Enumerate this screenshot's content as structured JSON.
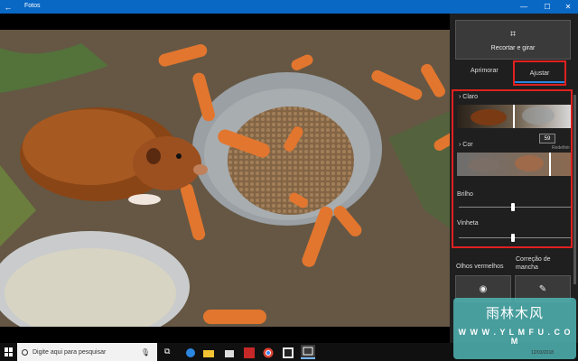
{
  "window": {
    "title": "Fotos"
  },
  "panel": {
    "crop_label": "Recortar e girar",
    "tabs": [
      {
        "label": "Aprimorar",
        "active": false
      },
      {
        "label": "Ajustar",
        "active": true
      }
    ],
    "sections": {
      "claro": "Claro",
      "cor": "Cor",
      "brilho": "Brilho",
      "vinheta": "Vinheta"
    },
    "tooltip_value": "59",
    "reset_label": "Redefinir",
    "options": [
      {
        "label": "Olhos vermelhos",
        "icon": "eye-icon"
      },
      {
        "label": "Correção de mancha",
        "icon": "spot-fix-icon"
      }
    ]
  },
  "taskbar": {
    "search_placeholder": "Digite aqui para pesquisar"
  },
  "watermark": {
    "title": "雨林木风",
    "url": "W W W . Y L M F U . C O M",
    "date": "12/03/2018"
  },
  "colors": {
    "accent": "#0a68c5",
    "highlight": "#e02020",
    "panel": "#1f1f1f"
  }
}
